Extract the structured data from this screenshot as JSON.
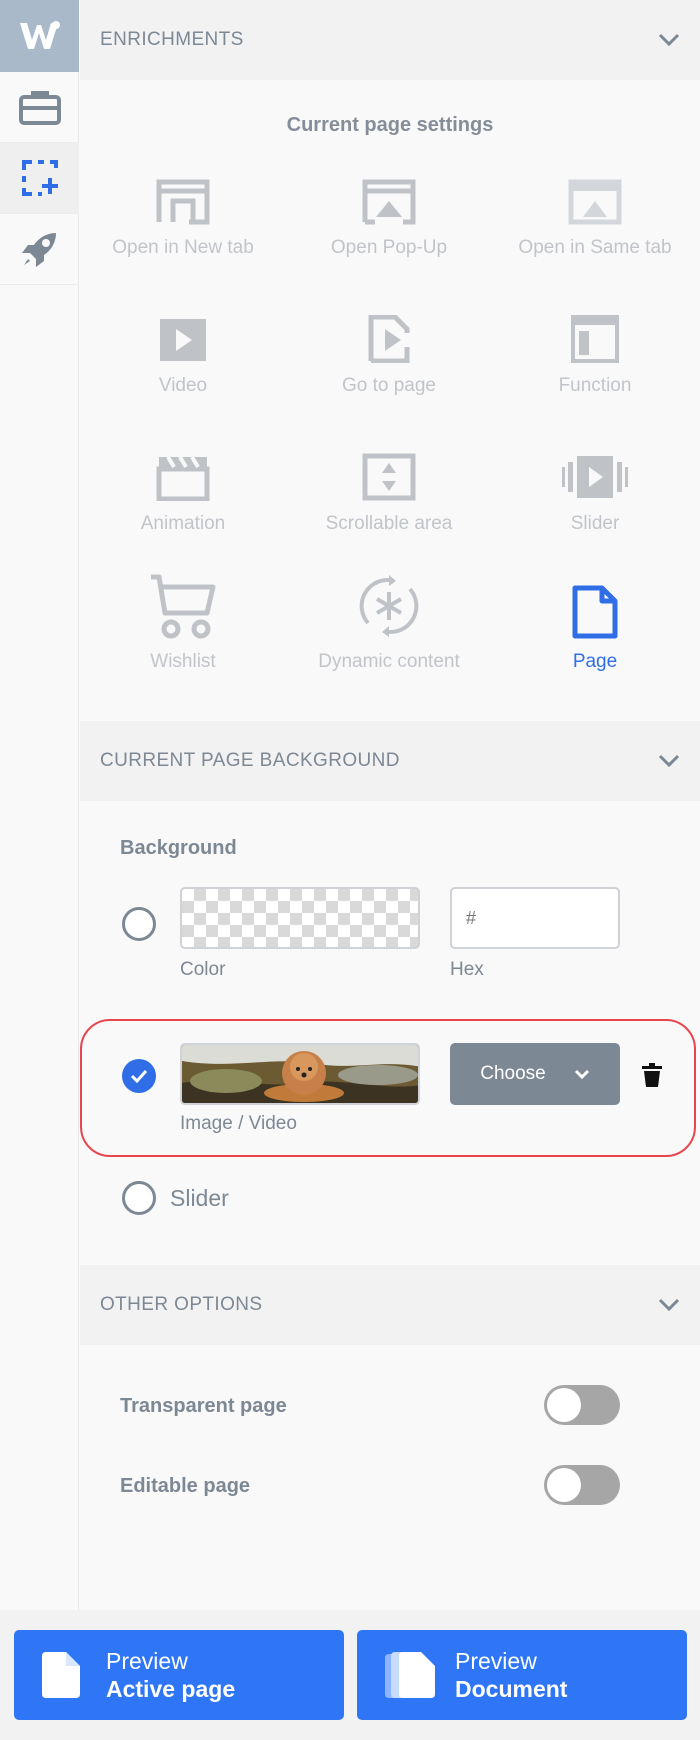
{
  "enrichments": {
    "title": "ENRICHMENTS",
    "subtitle": "Current page settings",
    "tiles": [
      {
        "label": "Open in New tab"
      },
      {
        "label": "Open Pop-Up"
      },
      {
        "label": "Open in Same tab"
      },
      {
        "label": "Video"
      },
      {
        "label": "Go to page"
      },
      {
        "label": "Function"
      },
      {
        "label": "Animation"
      },
      {
        "label": "Scrollable area"
      },
      {
        "label": "Slider"
      },
      {
        "label": "Wishlist"
      },
      {
        "label": "Dynamic content"
      },
      {
        "label": "Page",
        "selected": true
      }
    ]
  },
  "background": {
    "section_title": "CURRENT PAGE BACKGROUND",
    "title": "Background",
    "color_caption": "Color",
    "hex_caption": "Hex",
    "hex_placeholder": "#",
    "image_caption": "Image / Video",
    "choose_label": "Choose",
    "slider_label": "Slider",
    "selected": "Image / Video"
  },
  "other": {
    "section_title": "OTHER OPTIONS",
    "transparent_label": "Transparent page",
    "transparent_on": false,
    "editable_label": "Editable page",
    "editable_on": false
  },
  "footer": {
    "preview_active_line1": "Preview",
    "preview_active_line2": "Active page",
    "preview_doc_line1": "Preview",
    "preview_doc_line2": "Document"
  },
  "colors": {
    "accent": "#2f76f6",
    "selected_blue": "#2f6ee6",
    "highlight_border": "#e8464f",
    "muted": "#7d8895"
  }
}
